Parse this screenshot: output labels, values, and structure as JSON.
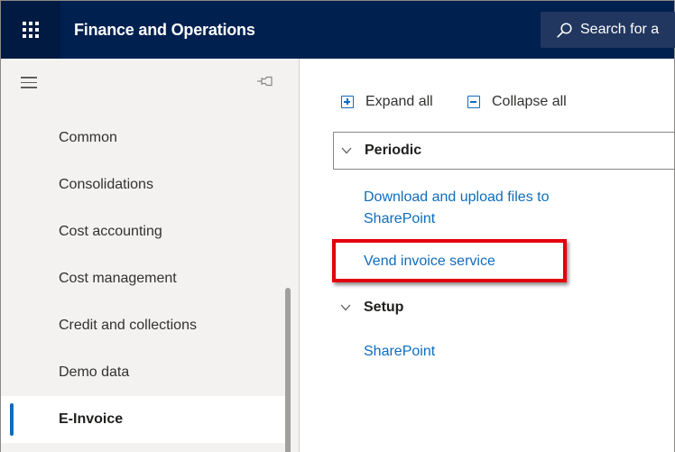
{
  "app": {
    "title": "Finance and Operations",
    "search_placeholder": "Search for a"
  },
  "nav": {
    "items": [
      {
        "label": "Common"
      },
      {
        "label": "Consolidations"
      },
      {
        "label": "Cost accounting"
      },
      {
        "label": "Cost management"
      },
      {
        "label": "Credit and collections"
      },
      {
        "label": "Demo data"
      },
      {
        "label": "E-Invoice",
        "active": true
      }
    ]
  },
  "toolbar": {
    "expand_all": "Expand all",
    "collapse_all": "Collapse all"
  },
  "sections": [
    {
      "title": "Periodic",
      "links": [
        "Download and upload files to",
        "SharePoint",
        "Vend invoice service"
      ]
    },
    {
      "title": "Setup",
      "links": [
        "SharePoint"
      ]
    }
  ],
  "colors": {
    "header_bg": "#002050",
    "accent": "#0f6cbd",
    "highlight": "#e3000f"
  },
  "icons": {
    "app_launcher": "waffle-icon",
    "search": "search-icon",
    "menu": "hamburger-icon",
    "pin": "pin-icon",
    "expand": "expand-all-icon",
    "collapse": "collapse-all-icon",
    "chevron": "chevron-down-icon"
  }
}
